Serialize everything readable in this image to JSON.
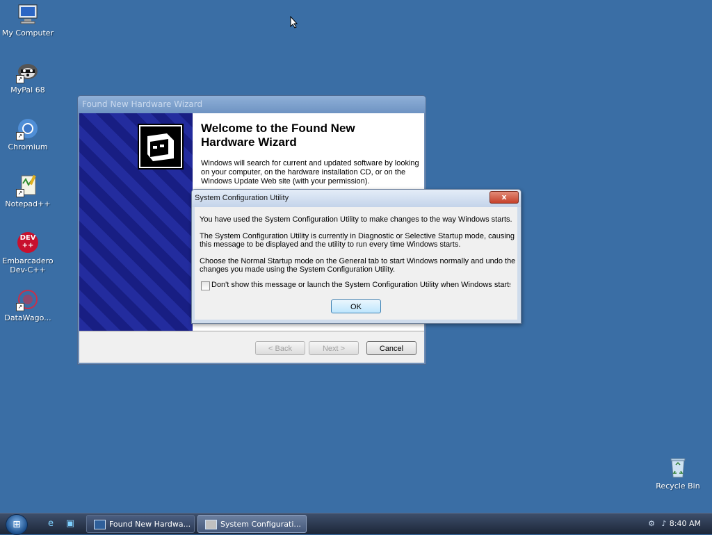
{
  "desktop": {
    "icons": [
      {
        "label": "My Computer",
        "icon": "computer-icon"
      },
      {
        "label": "MyPal 68",
        "icon": "raccoon-browser-icon"
      },
      {
        "label": "Chromium",
        "icon": "chromium-icon"
      },
      {
        "label": "Notepad++",
        "icon": "notepadpp-icon"
      },
      {
        "label": "Embarcadero Dev-C++",
        "icon": "devcpp-icon",
        "icon_text": "DEV\n++"
      },
      {
        "label": "DataWago...",
        "icon": "datawagon-icon"
      }
    ],
    "recycle_bin": {
      "label": "Recycle Bin",
      "icon": "recycle-bin-icon"
    }
  },
  "wizard": {
    "title": "Found New Hardware Wizard",
    "heading": "Welcome to the Found New Hardware Wizard",
    "description": "Windows will search for current and updated software by looking on your computer, on the hardware installation CD, or on the Windows Update Web site (with your permission).",
    "back_label": "< Back",
    "next_label": "Next >",
    "cancel_label": "Cancel"
  },
  "sysconf": {
    "title": "System Configuration Utility",
    "close_label": "x",
    "para1": "You have used the System Configuration Utility to make changes to the way Windows starts.",
    "para2": "The System Configuration Utility is currently in Diagnostic or Selective Startup mode, causing this message to be displayed and the utility to run every time Windows starts.",
    "para3": "Choose the Normal Startup mode on the General tab to start Windows normally and undo the changes you made using the System Configuration Utility.",
    "checkbox_label": "Don't show this message or launch the System Configuration Utility when Windows starts",
    "checkbox_checked": false,
    "ok_label": "OK"
  },
  "taskbar": {
    "tasks": [
      {
        "label": "Found New Hardwa...",
        "active": false
      },
      {
        "label": "System Configurati...",
        "active": true
      }
    ],
    "clock": "8:40 AM"
  },
  "colors": {
    "desktop": "#3a6ea5",
    "taskbar": "#1c2638",
    "accent": "#3c7fb1"
  }
}
